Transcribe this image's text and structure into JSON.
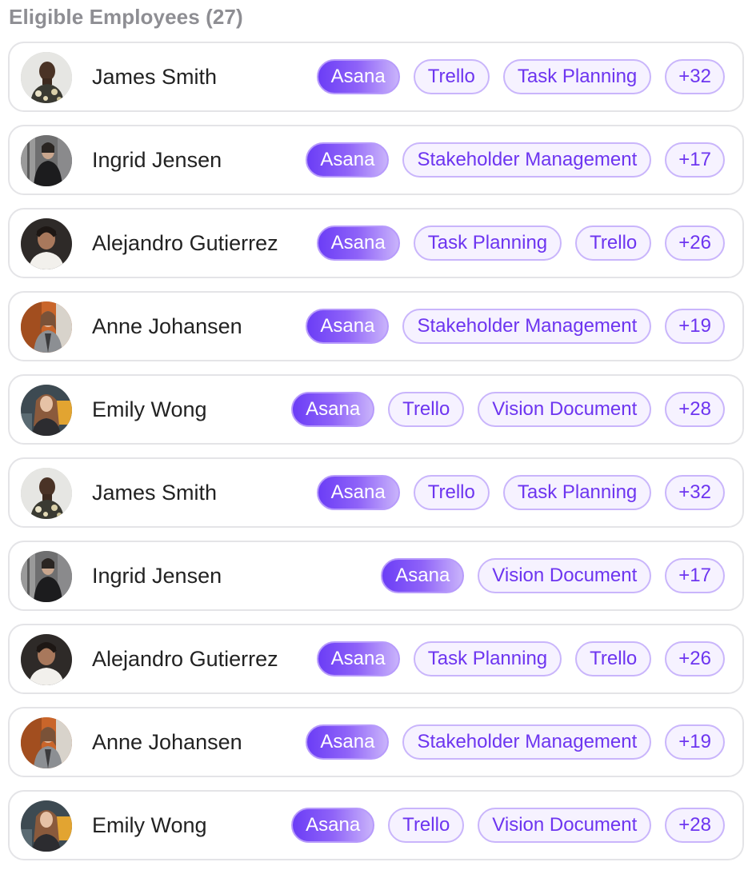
{
  "section_title": "Eligible Employees (27)",
  "colors": {
    "accent": "#6d35f0",
    "tag_border": "#c9b5fb",
    "tag_bg": "#f6f2ff",
    "card_border": "#e4e4e7",
    "title_gray": "#8e8e93"
  },
  "employees": [
    {
      "name": "James Smith",
      "avatar": "man-floral-shirt",
      "tags": [
        {
          "label": "Asana",
          "primary": true
        },
        {
          "label": "Trello"
        },
        {
          "label": "Task Planning"
        }
      ],
      "more": "+32"
    },
    {
      "name": "Ingrid Jensen",
      "avatar": "woman-black-top",
      "tags": [
        {
          "label": "Asana",
          "primary": true
        },
        {
          "label": "Stakeholder Management"
        }
      ],
      "more": "+17"
    },
    {
      "name": "Alejandro Gutierrez",
      "avatar": "man-white-tee",
      "tags": [
        {
          "label": "Asana",
          "primary": true
        },
        {
          "label": "Task Planning"
        },
        {
          "label": "Trello"
        }
      ],
      "more": "+26"
    },
    {
      "name": "Anne Johansen",
      "avatar": "woman-gray-jacket",
      "tags": [
        {
          "label": "Asana",
          "primary": true
        },
        {
          "label": "Stakeholder Management"
        }
      ],
      "more": "+19"
    },
    {
      "name": "Emily Wong",
      "avatar": "woman-long-hair",
      "tags": [
        {
          "label": "Asana",
          "primary": true
        },
        {
          "label": "Trello"
        },
        {
          "label": "Vision Document"
        }
      ],
      "more": "+28"
    },
    {
      "name": "James Smith",
      "avatar": "man-floral-shirt",
      "tags": [
        {
          "label": "Asana",
          "primary": true
        },
        {
          "label": "Trello"
        },
        {
          "label": "Task Planning"
        }
      ],
      "more": "+32"
    },
    {
      "name": "Ingrid Jensen",
      "avatar": "woman-black-top",
      "tags": [
        {
          "label": "Asana",
          "primary": true
        },
        {
          "label": "Vision Document"
        }
      ],
      "more": "+17"
    },
    {
      "name": "Alejandro Gutierrez",
      "avatar": "man-white-tee",
      "tags": [
        {
          "label": "Asana",
          "primary": true
        },
        {
          "label": "Task Planning"
        },
        {
          "label": "Trello"
        }
      ],
      "more": "+26"
    },
    {
      "name": "Anne Johansen",
      "avatar": "woman-gray-jacket",
      "tags": [
        {
          "label": "Asana",
          "primary": true
        },
        {
          "label": "Stakeholder Management"
        }
      ],
      "more": "+19"
    },
    {
      "name": "Emily Wong",
      "avatar": "woman-long-hair",
      "tags": [
        {
          "label": "Asana",
          "primary": true
        },
        {
          "label": "Trello"
        },
        {
          "label": "Vision Document"
        }
      ],
      "more": "+28"
    }
  ]
}
